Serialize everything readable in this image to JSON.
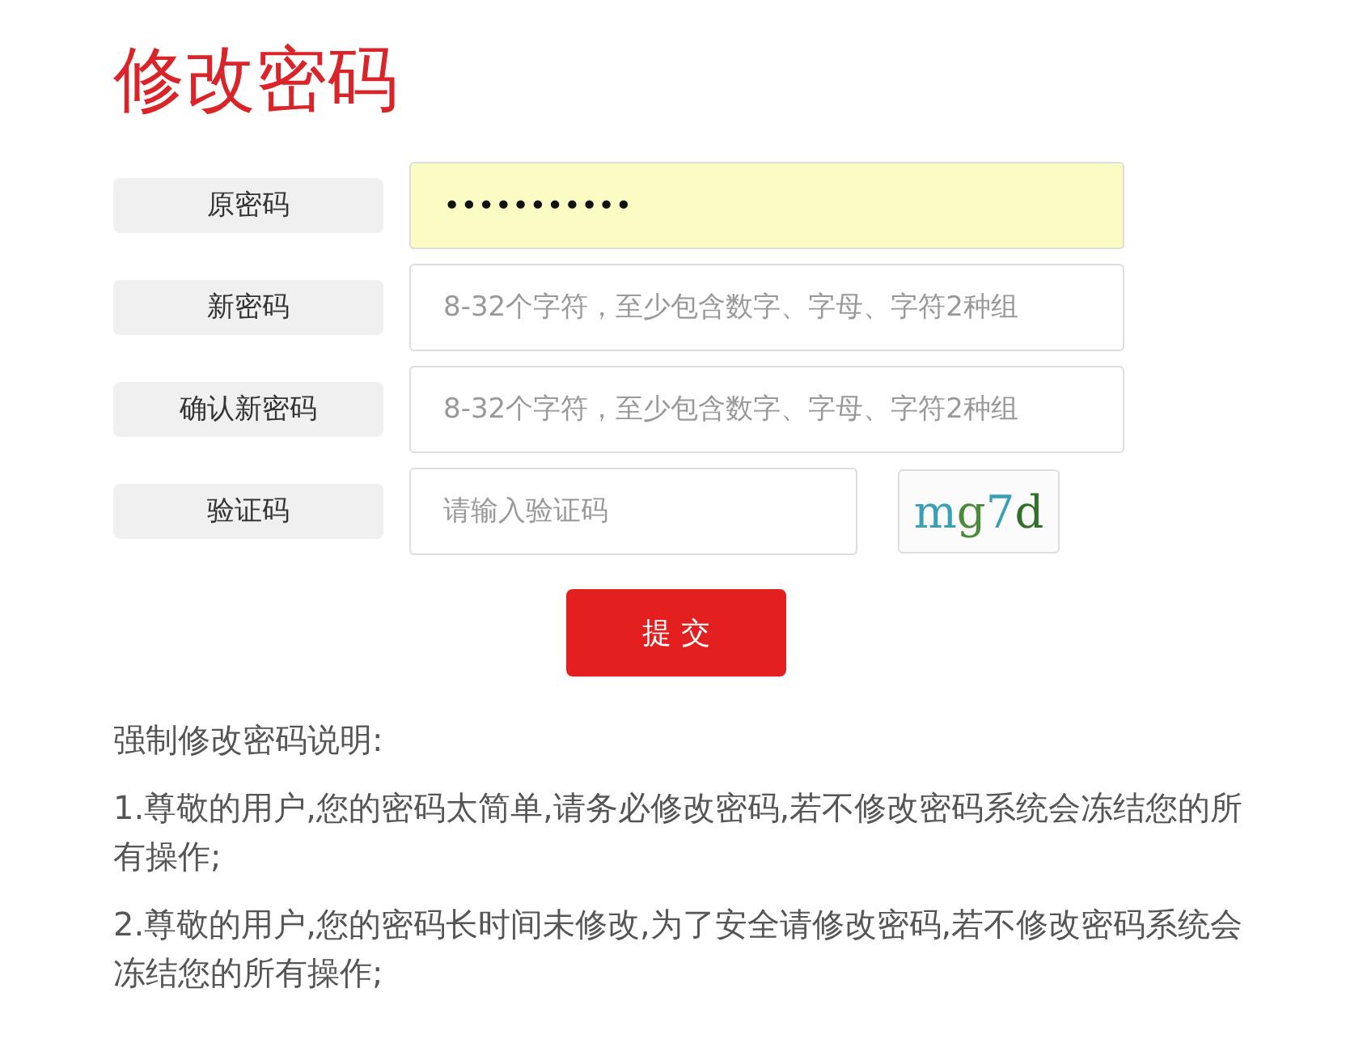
{
  "title": "修改密码",
  "fields": [
    {
      "label": "原密码",
      "kind": "password",
      "value": "•••••••••••",
      "autofilled": true
    },
    {
      "label": "新密码",
      "kind": "text",
      "placeholder": "8-32个字符，至少包含数字、字母、字符2种组"
    },
    {
      "label": "确认新密码",
      "kind": "text",
      "placeholder": "8-32个字符，至少包含数字、字母、字符2种组"
    },
    {
      "label": "验证码",
      "kind": "captcha",
      "placeholder": "请输入验证码",
      "captcha": "mg7d"
    }
  ],
  "submit": "提 交",
  "notes_title": "强制修改密码说明:",
  "notes": [
    "1.尊敬的用户,您的密码太简单,请务必修改密码,若不修改密码系统会冻结您的所有操作;",
    "2.尊敬的用户,您的密码长时间未修改,为了安全请修改密码,若不修改密码系统会冻结您的所有操作;"
  ]
}
